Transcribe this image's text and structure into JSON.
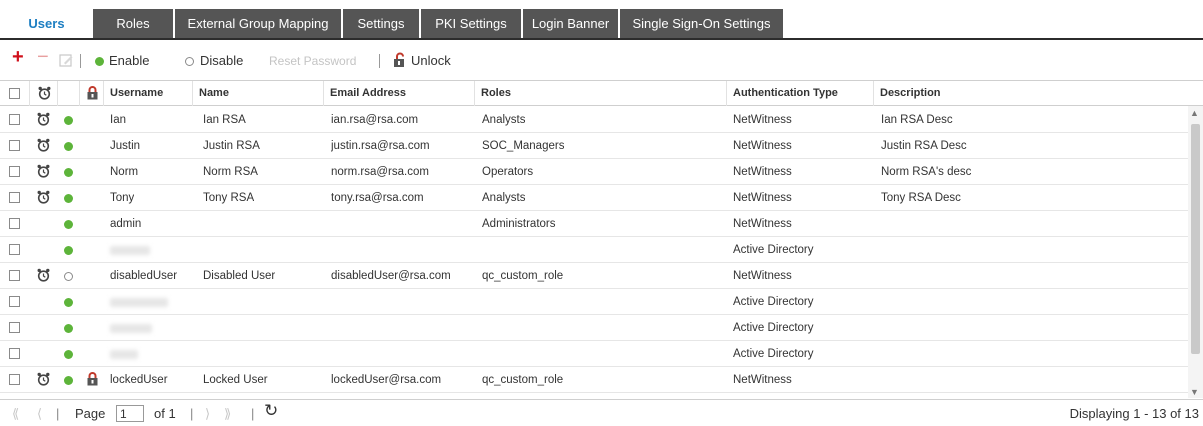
{
  "tabs": [
    {
      "label": "Users",
      "active": true
    },
    {
      "label": "Roles",
      "active": false
    },
    {
      "label": "External Group Mapping",
      "active": false
    },
    {
      "label": "Settings",
      "active": false
    },
    {
      "label": "PKI Settings",
      "active": false
    },
    {
      "label": "Login Banner",
      "active": false
    },
    {
      "label": "Single Sign-On Settings",
      "active": false
    }
  ],
  "toolbar": {
    "add_label": "+",
    "remove_label": "−",
    "enable_label": "Enable",
    "disable_label": "Disable",
    "reset_password_label": "Reset Password",
    "unlock_label": "Unlock"
  },
  "columns": {
    "username": "Username",
    "name": "Name",
    "email": "Email Address",
    "roles": "Roles",
    "auth": "Authentication Type",
    "description": "Description"
  },
  "rows": [
    {
      "alarm": true,
      "enabled": true,
      "locked": false,
      "username": "Ian",
      "name": "Ian RSA",
      "email": "ian.rsa@rsa.com",
      "roles": "Analysts",
      "auth": "NetWitness",
      "description": "Ian RSA Desc"
    },
    {
      "alarm": true,
      "enabled": true,
      "locked": false,
      "username": "Justin",
      "name": "Justin RSA",
      "email": "justin.rsa@rsa.com",
      "roles": "SOC_Managers",
      "auth": "NetWitness",
      "description": "Justin RSA Desc"
    },
    {
      "alarm": true,
      "enabled": true,
      "locked": false,
      "username": "Norm",
      "name": "Norm RSA",
      "email": "norm.rsa@rsa.com",
      "roles": "Operators",
      "auth": "NetWitness",
      "description": "Norm RSA's desc"
    },
    {
      "alarm": true,
      "enabled": true,
      "locked": false,
      "username": "Tony",
      "name": "Tony RSA",
      "email": "tony.rsa@rsa.com",
      "roles": "Analysts",
      "auth": "NetWitness",
      "description": "Tony RSA Desc"
    },
    {
      "alarm": false,
      "enabled": true,
      "locked": false,
      "username": "admin",
      "name": "",
      "email": "",
      "roles": "Administrators",
      "auth": "NetWitness",
      "description": ""
    },
    {
      "alarm": false,
      "enabled": true,
      "locked": false,
      "username": "",
      "name": "",
      "email": "",
      "roles": "",
      "auth": "Active Directory",
      "description": "",
      "redacted": true
    },
    {
      "alarm": true,
      "enabled": false,
      "locked": false,
      "username": "disabledUser",
      "name": "Disabled User",
      "email": "disabledUser@rsa.com",
      "roles": "qc_custom_role",
      "auth": "NetWitness",
      "description": ""
    },
    {
      "alarm": false,
      "enabled": true,
      "locked": false,
      "username": "",
      "name": "",
      "email": "",
      "roles": "",
      "auth": "Active Directory",
      "description": "",
      "redacted": true
    },
    {
      "alarm": false,
      "enabled": true,
      "locked": false,
      "username": "",
      "name": "",
      "email": "",
      "roles": "",
      "auth": "Active Directory",
      "description": "",
      "redacted": true
    },
    {
      "alarm": false,
      "enabled": true,
      "locked": false,
      "username": "",
      "name": "",
      "email": "",
      "roles": "",
      "auth": "Active Directory",
      "description": "",
      "redacted": true
    },
    {
      "alarm": true,
      "enabled": true,
      "locked": true,
      "username": "lockedUser",
      "name": "Locked User",
      "email": "lockedUser@rsa.com",
      "roles": "qc_custom_role",
      "auth": "NetWitness",
      "description": ""
    }
  ],
  "pager": {
    "page_label": "Page",
    "page_value": "1",
    "of_label": "of 1",
    "display_text": "Displaying 1 - 13 of 13"
  },
  "colors": {
    "accent": "#1e7fc2",
    "tab_bg": "#555555",
    "enabled_dot": "#5db43a",
    "add_icon": "#d0101b",
    "remove_icon": "#e8a0a0"
  }
}
